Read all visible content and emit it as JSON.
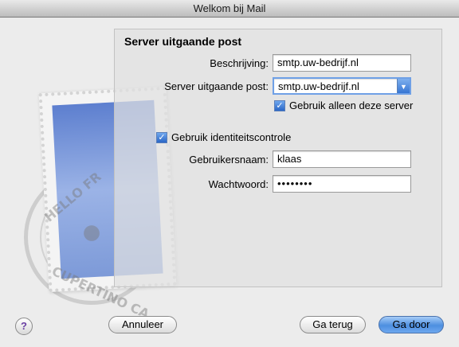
{
  "window": {
    "title": "Welkom bij Mail"
  },
  "stamp": {
    "postmark_text_top": "HELLO FR",
    "postmark_text_bottom": "CUPERTINO CA"
  },
  "panel": {
    "title": "Server uitgaande post",
    "description_label": "Beschrijving:",
    "description_value": "smtp.uw-bedrijf.nl",
    "server_label": "Server uitgaande post:",
    "server_value": "smtp.uw-bedrijf.nl",
    "only_this_server_label": "Gebruik alleen deze server",
    "only_this_server_checked": true,
    "auth_label": "Gebruik identiteitscontrole",
    "auth_checked": true,
    "username_label": "Gebruikersnaam:",
    "username_value": "klaas",
    "password_label": "Wachtwoord:",
    "password_value": "••••••••"
  },
  "footer": {
    "help_label": "?",
    "cancel_label": "Annuleer",
    "back_label": "Ga terug",
    "continue_label": "Ga door"
  },
  "colors": {
    "accent": "#3b7ad9",
    "help_mark": "#6a3fa3"
  }
}
